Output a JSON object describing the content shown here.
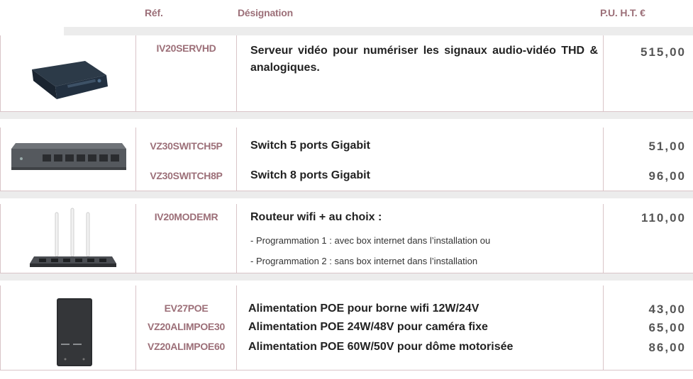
{
  "header": {
    "ref_label": "Réf.",
    "designation_label": "Désignation",
    "price_label": "P.U. H.T. €"
  },
  "groups": [
    {
      "image": "video-server-box",
      "rows": [
        {
          "ref": "IV20SERVHD",
          "designation": "Serveur vidéo pour numériser les signaux audio-vidéo THD & analogiques.",
          "price": "515,00"
        }
      ]
    },
    {
      "image": "network-switch",
      "rows": [
        {
          "ref": "VZ30SWITCH5P",
          "designation": "Switch 5 ports Gigabit",
          "price": "51,00"
        },
        {
          "ref": "VZ30SWITCH8P",
          "designation": "Switch 8 ports Gigabit",
          "price": "96,00"
        }
      ]
    },
    {
      "image": "wifi-router",
      "rows": [
        {
          "ref": "IV20MODEMR",
          "designation": "Routeur wifi + au choix :",
          "price": "110,00"
        }
      ],
      "notes": [
        "- Programmation 1 : avec box internet  dans l’installation ou",
        "- Programmation 2 : sans box internet  dans l’installation"
      ]
    },
    {
      "image": "poe-power-supply",
      "rows": [
        {
          "ref": "EV27POE",
          "designation": "Alimentation POE pour borne wifi 12W/24V",
          "price": "43,00"
        },
        {
          "ref": "VZ20ALIMPOE30",
          "designation": "Alimentation POE 24W/48V pour caméra fixe",
          "price": "65,00"
        },
        {
          "ref": "VZ20ALIMPOE60",
          "designation": "Alimentation POE 60W/50V pour dôme motorisée",
          "price": "86,00"
        }
      ]
    }
  ]
}
